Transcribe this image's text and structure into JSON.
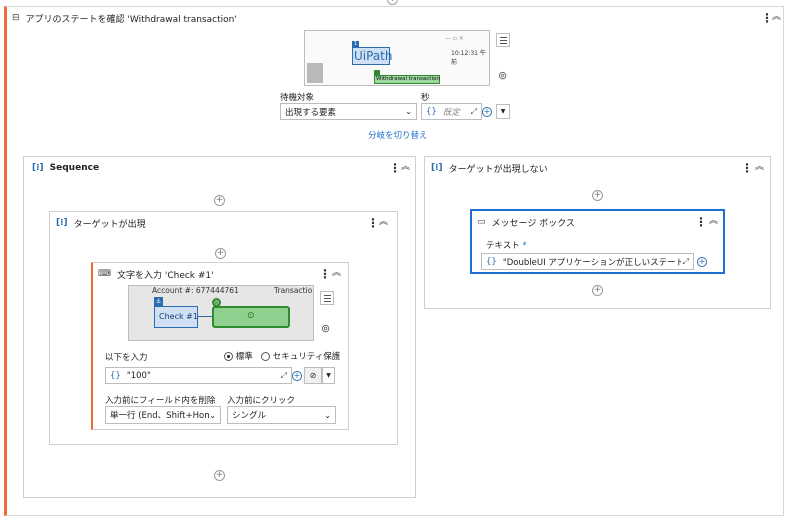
{
  "main": {
    "title": "アプリのステートを確認 'Withdrawal transaction'",
    "preview": {
      "app_name": "UiPath",
      "time": "10:12:31 午前",
      "target_label": "Withdrawal transaction",
      "anchor_badge": "1"
    },
    "wait_for": {
      "label": "待機対象",
      "value": "出現する要素"
    },
    "seconds": {
      "label": "秒",
      "value": "既定"
    },
    "toggle_link": "分岐を切り替え"
  },
  "sequence": {
    "title": "Sequence",
    "found": {
      "title": "ターゲットが出現",
      "type_into": {
        "title": "文字を入力 'Check #1'",
        "preview_account": "Account #: 677444761",
        "preview_trans": "Transactio",
        "preview_check": "Check #1",
        "input_label": "以下を入力",
        "radio_standard": "標準",
        "radio_secure": "セキュリティ保護",
        "input_value": "\"100\"",
        "clear_label": "入力前にフィールド内を削除",
        "clear_value": "単一行 (End、Shift+Hom",
        "click_label": "入力前にクリック",
        "click_value": "シングル"
      }
    }
  },
  "not_found": {
    "title": "ターゲットが出現しない",
    "message_box": {
      "title": "メッセージ ボックス",
      "text_label": "テキスト",
      "required_mark": "*",
      "text_value": "\"DoubleUI アプリケーションが正しいステートにあり"
    }
  },
  "colors": {
    "accent": "#ef6c3a",
    "blue": "#2b6cb0",
    "link": "#1f6fd1",
    "green": "#5cb85c"
  }
}
